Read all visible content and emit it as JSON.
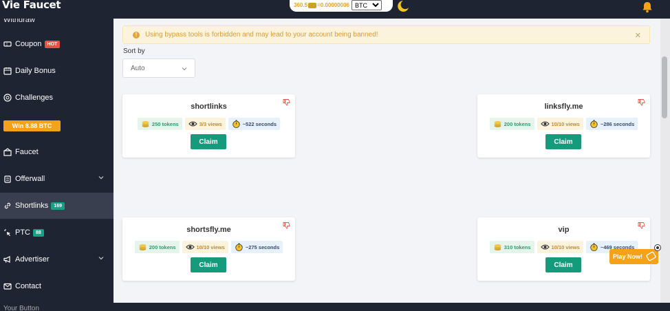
{
  "header": {
    "brand": "Vie Faucet",
    "balance_tokens": "360.5",
    "balance_btc": "=0.00000006",
    "currency_selected": "BTC"
  },
  "sidebar": {
    "cut_top": "Withdraw",
    "items": [
      {
        "label": "Coupon",
        "badge": "HOT"
      },
      {
        "label": "Daily Bonus"
      },
      {
        "label": "Challenges"
      },
      {
        "label": "Faucet"
      },
      {
        "label": "Offerwall"
      },
      {
        "label": "Shortlinks",
        "badge": "169"
      },
      {
        "label": "PTC",
        "badge": "88"
      },
      {
        "label": "Advertiser"
      },
      {
        "label": "Contact"
      }
    ],
    "win_button": "Win 8.88 BTC",
    "cut_bottom": "Your Button"
  },
  "alert": {
    "text": "Using bypass tools is forbidden and may lead to your account being banned!"
  },
  "sort": {
    "label": "Sort by",
    "value": "Auto"
  },
  "cards": [
    {
      "title": "shortlinks",
      "tokens": "250 tokens",
      "views": "3/3 views",
      "seconds": "~522 seconds",
      "button": "Claim"
    },
    {
      "title": "linksfly.me",
      "tokens": "200 tokens",
      "views": "10/10 views",
      "seconds": "~286 seconds",
      "button": "Claim"
    },
    {
      "title": "shortsfly.me",
      "tokens": "200 tokens",
      "views": "10/10 views",
      "seconds": "~275 seconds",
      "button": "Claim"
    },
    {
      "title": "vip",
      "tokens": "310 tokens",
      "views": "10/10 views",
      "seconds": "~469 seconds",
      "button": "Claim"
    }
  ],
  "play_now": "Play Now!",
  "colors": {
    "dark_bg": "#1f2433",
    "accent_green": "#169a7c",
    "hot_red": "#e05545",
    "orange": "#f5a21b"
  }
}
